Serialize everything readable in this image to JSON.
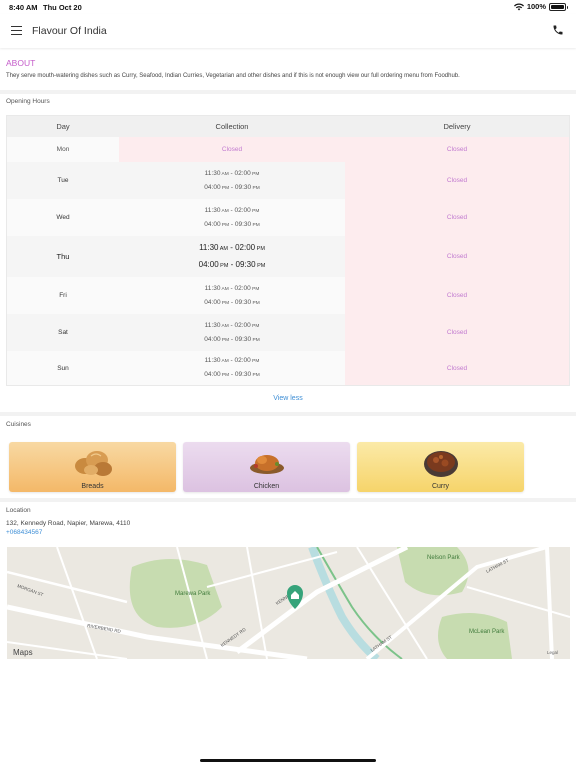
{
  "status_bar": {
    "time": "8:40 AM",
    "date": "Thu Oct 20",
    "battery": "100%"
  },
  "header": {
    "title": "Flavour Of India",
    "menu_icon": "hamburger-menu-icon",
    "call_icon": "phone-icon"
  },
  "about": {
    "heading": "ABOUT",
    "text": "They serve mouth-watering dishes such as Curry, Seafood, Indian Curries, Vegetarian and other dishes and if this is not enough view our full ordering menu from Foodhub."
  },
  "opening_hours": {
    "label": "Opening Hours",
    "columns": [
      "Day",
      "Collection",
      "Delivery"
    ],
    "rows": [
      {
        "day": "Mon",
        "collection": [
          "Closed"
        ],
        "delivery": "Closed"
      },
      {
        "day": "Tue",
        "collection": [
          [
            "11:30",
            "AM",
            "02:00",
            "PM"
          ],
          [
            "04:00",
            "PM",
            "09:30",
            "PM"
          ]
        ],
        "delivery": "Closed"
      },
      {
        "day": "Wed",
        "collection": [
          [
            "11:30",
            "AM",
            "02:00",
            "PM"
          ],
          [
            "04:00",
            "PM",
            "09:30",
            "PM"
          ]
        ],
        "delivery": "Closed"
      },
      {
        "day": "Thu",
        "collection": [
          [
            "11:30",
            "AM",
            "02:00",
            "PM"
          ],
          [
            "04:00",
            "PM",
            "09:30",
            "PM"
          ]
        ],
        "delivery": "Closed"
      },
      {
        "day": "Fri",
        "collection": [
          [
            "11:30",
            "AM",
            "02:00",
            "PM"
          ],
          [
            "04:00",
            "PM",
            "09:30",
            "PM"
          ]
        ],
        "delivery": "Closed"
      },
      {
        "day": "Sat",
        "collection": [
          [
            "11:30",
            "AM",
            "02:00",
            "PM"
          ],
          [
            "04:00",
            "PM",
            "09:30",
            "PM"
          ]
        ],
        "delivery": "Closed"
      },
      {
        "day": "Sun",
        "collection": [
          [
            "11:30",
            "AM",
            "02:00",
            "PM"
          ],
          [
            "04:00",
            "PM",
            "09:30",
            "PM"
          ]
        ],
        "delivery": "Closed"
      }
    ],
    "today": "Thu",
    "view_less": "View less"
  },
  "cuisines": {
    "label": "Cuisines",
    "items": [
      {
        "name": "Breads",
        "icon": "bread-icon",
        "colors": [
          "#f8d9a3",
          "#f4b868"
        ]
      },
      {
        "name": "Chicken",
        "icon": "roast-chicken-icon",
        "colors": [
          "#ecdcef",
          "#dcc2e1"
        ]
      },
      {
        "name": "Curry",
        "icon": "curry-bowl-icon",
        "colors": [
          "#fbeaa8",
          "#f6d46a"
        ]
      }
    ]
  },
  "location": {
    "label": "Location",
    "address": "132, Kennedy Road, Napier, Marewa, 4110",
    "phone": "+068434567",
    "map": {
      "attribution": "Maps",
      "legal": "Legal",
      "parks": [
        "Marewa Park",
        "Nelson Park",
        "McLean Park"
      ],
      "streets": [
        "KENNEDY RD",
        "RIVERBEND RD",
        "LATHAM ST",
        "HASTINGS ST",
        "MORGAN ST",
        "GLOUCESTER ST",
        "NELSON ST",
        "WELLESLEY RD",
        "BARE RD"
      ]
    }
  },
  "colors": {
    "accent": "#c45bc9",
    "link": "#3f8fd6",
    "closed": "#c27bd0",
    "closed_bg": "#fdecee"
  }
}
